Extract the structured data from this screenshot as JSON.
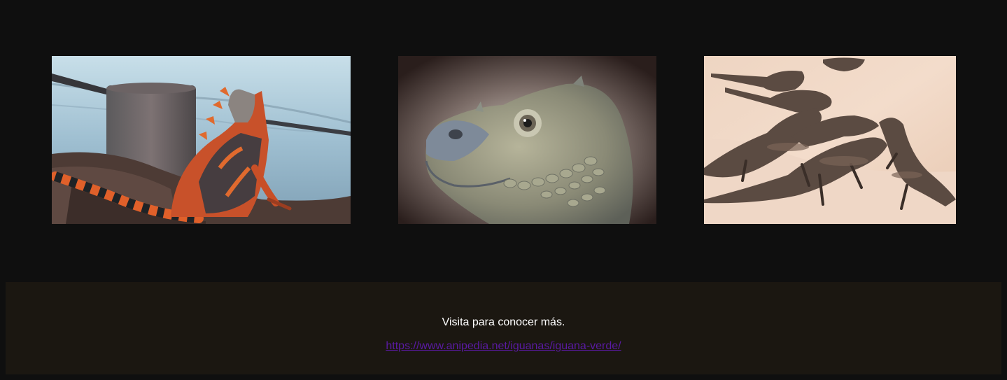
{
  "gallery": {
    "images": [
      {
        "subject": "orange-and-black iguana on rocks by the water"
      },
      {
        "subject": "close-up of a grey iguana head"
      },
      {
        "subject": "group of iguanas on a sandy beach"
      }
    ]
  },
  "footer": {
    "text": "Visita para conocer más.",
    "link_text": "https://www.anipedia.net/iguanas/iguana-verde/",
    "link_href": "https://www.anipedia.net/iguanas/iguana-verde/"
  },
  "colors": {
    "page_background": "#0f0f0f",
    "footer_background": "#1b1711",
    "footer_text": "#ffffff",
    "link": "#5a1aa3"
  }
}
